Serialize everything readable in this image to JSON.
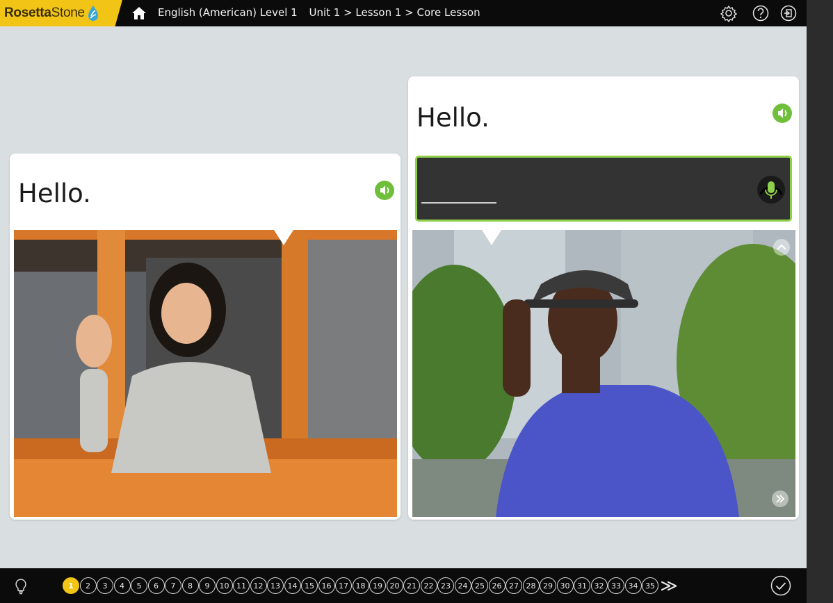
{
  "app": {
    "logo_word1": "Rosetta",
    "logo_word2": "Stone"
  },
  "header": {
    "course": "English (American) Level 1",
    "location": "Unit 1 > Lesson 1 > Core Lesson"
  },
  "icons": {
    "home": "home-icon",
    "settings": "gear-icon",
    "help": "help-icon",
    "exit": "exit-icon",
    "speaker": "speaker-icon",
    "microphone": "microphone-icon",
    "hint": "lightbulb-icon",
    "done": "checkmark-icon"
  },
  "colors": {
    "brand": "#f2c416",
    "accent_green": "#8fd04a",
    "speaker_green": "#6fbf3a"
  },
  "cards": [
    {
      "phrase": "Hello."
    },
    {
      "phrase": "Hello."
    }
  ],
  "progress": {
    "current_step": 1,
    "steps": [
      "1",
      "2",
      "3",
      "4",
      "5",
      "6",
      "7",
      "8",
      "9",
      "10",
      "11",
      "12",
      "13",
      "14",
      "15",
      "16",
      "17",
      "18",
      "19",
      "20",
      "21",
      "22",
      "23",
      "24",
      "25",
      "26",
      "27",
      "28",
      "29",
      "30",
      "31",
      "32",
      "33",
      "34",
      "35"
    ],
    "more": "≫"
  }
}
